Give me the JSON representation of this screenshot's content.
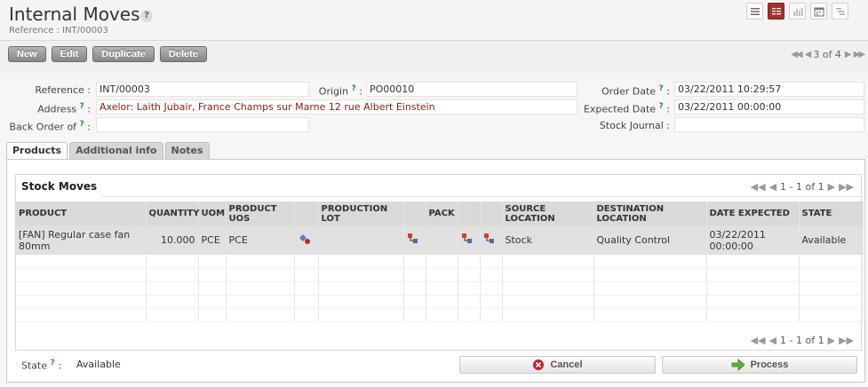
{
  "header": {
    "title": "Internal Moves",
    "help": "?",
    "reference_line": "Reference : INT/00003"
  },
  "views": [
    "list-view-icon",
    "form-view-icon",
    "graph-view-icon",
    "calendar-view-icon",
    "gantt-view-icon"
  ],
  "toolbar": {
    "new": "New",
    "edit": "Edit",
    "duplicate": "Duplicate",
    "delete": "Delete"
  },
  "pager": {
    "label": "3 of 4"
  },
  "form": {
    "reference_label": "Reference",
    "reference_value": "INT/00003",
    "origin_label": "Origin",
    "origin_value": "PO00010",
    "order_date_label": "Order Date",
    "order_date_value": "03/22/2011 10:29:57",
    "address_label": "Address",
    "address_value": "Axelor: Laith Jubair, France Champs sur Marne 12 rue Albert Einstein",
    "expected_date_label": "Expected Date",
    "expected_date_value": "03/22/2011 00:00:00",
    "back_order_label": "Back Order of",
    "back_order_value": "",
    "stock_journal_label": "Stock Journal",
    "stock_journal_value": "",
    "colon": ":",
    "q": "?"
  },
  "tabs": [
    "Products",
    "Additional info",
    "Notes"
  ],
  "stock_moves": {
    "title": "Stock Moves",
    "pager": "1 - 1 of 1",
    "headers": {
      "product": "PRODUCT",
      "quantity": "QUANTITY",
      "uom": "UOM",
      "product_uos": "PRODUCT UOS",
      "production_lot": "PRODUCTION LOT",
      "pack": "PACK",
      "source_location": "SOURCE LOCATION",
      "destination_location": "DESTINATION LOCATION",
      "date_expected": "DATE EXPECTED",
      "state": "STATE"
    },
    "row": {
      "product": "[FAN] Regular case fan 80mm",
      "quantity": "10.000",
      "uom": "PCE",
      "product_uos": "PCE",
      "production_lot": "",
      "pack": "",
      "source_location": "Stock",
      "destination_location": "Quality Control",
      "date_expected": "03/22/2011 00:00:00",
      "state": "Available"
    }
  },
  "footer": {
    "state_label": "State",
    "state_value": "Available",
    "cancel": "Cancel",
    "process": "Process"
  },
  "colors": {
    "accent": "#a83030",
    "link": "#8b1a1a",
    "help": "#2f8f2f"
  }
}
